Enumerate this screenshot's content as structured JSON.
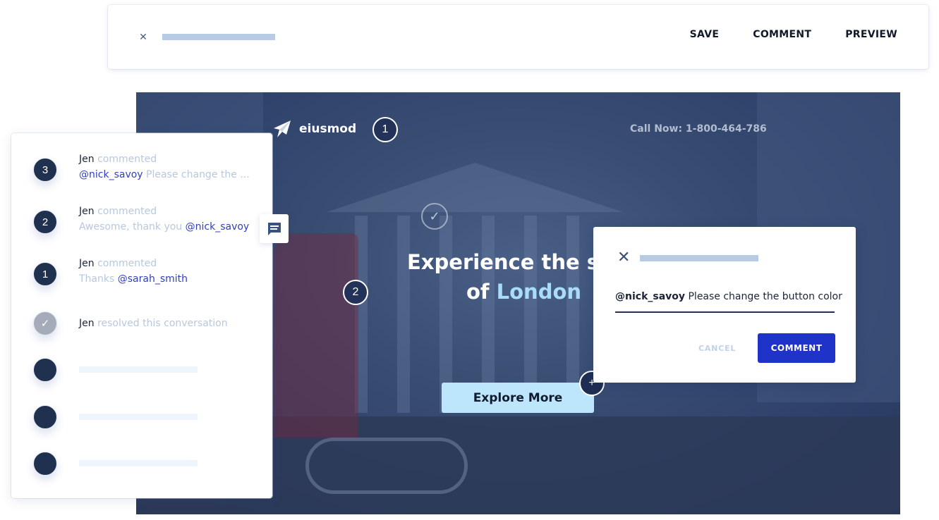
{
  "toolbar": {
    "close_icon": "close-icon",
    "title_placeholder": "",
    "actions": {
      "save": "SAVE",
      "comment": "COMMENT",
      "preview": "PREVIEW"
    }
  },
  "preview": {
    "brand_name": "eiusmod",
    "brand_icon": "paper-plane-icon",
    "call_now": "Call Now: 1-800-464-786",
    "headline_line1": "Experience the sig",
    "headline_line2_prefix": "of ",
    "headline_line2_accent": "London",
    "cta_label": "Explore More",
    "markers": {
      "m1": "1",
      "m2": "2",
      "check": "✓",
      "plus": "+"
    },
    "colors": {
      "accent": "#a9dcf8",
      "cta_bg": "#bde6fc"
    }
  },
  "thread": {
    "items": [
      {
        "badge": "3",
        "author": "Jen",
        "action": "commented",
        "mention": "@nick_savoy",
        "text": "Please change the ..."
      },
      {
        "badge": "2",
        "author": "Jen",
        "action": "commented",
        "text": "Awesome, thank you ",
        "mention": "@nick_savoy"
      },
      {
        "badge": "1",
        "author": "Jen",
        "action": "commented",
        "text": "Thanks ",
        "mention": "@sarah_smith"
      },
      {
        "badge": "✓",
        "author": "Jen",
        "action": "resolved this conversation"
      }
    ],
    "comment_tab_icon": "comment-icon"
  },
  "dialog": {
    "mention": "@nick_savoy",
    "input_text": " Please change the button color",
    "cancel_label": "CANCEL",
    "submit_label": "COMMENT",
    "colors": {
      "submit_bg": "#1f33c8",
      "cancel": "#bfd2e8"
    }
  }
}
